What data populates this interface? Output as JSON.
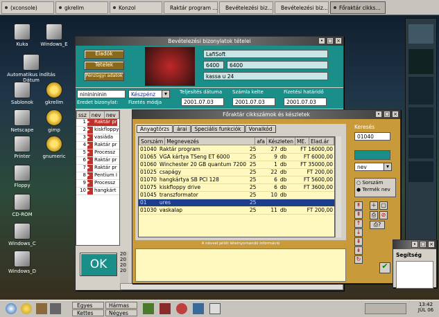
{
  "top_tasks": [
    {
      "label": "(xconsole)"
    },
    {
      "label": "gkrellm"
    },
    {
      "label": "Konzol"
    },
    {
      "label": "Raktár program ..."
    },
    {
      "label": "Bevételezési biz..."
    },
    {
      "label": "Bevételezési biz..."
    },
    {
      "label": "Főraktár cikks..."
    }
  ],
  "desktop_icons": [
    {
      "label": "Kuka"
    },
    {
      "label": "Windows_E"
    },
    {
      "label": "Automatikus indítás Dátum"
    },
    {
      "label": "Sablonok"
    },
    {
      "label": "gkrellm"
    },
    {
      "label": "Netscape"
    },
    {
      "label": "gimp"
    },
    {
      "label": "Printer"
    },
    {
      "label": "gnumeric"
    },
    {
      "label": "Floppy"
    },
    {
      "label": "CD-ROM"
    },
    {
      "label": "Windows_C"
    },
    {
      "label": "Windows_D"
    }
  ],
  "doc_window": {
    "title": "Bevételezési bizonylatok tételei",
    "buttons": {
      "eladok": "Eladók",
      "tetelek": "Tételek",
      "penzugyi": "Pénzügyi adatok"
    },
    "company": "LafiSoft",
    "code1": "6400",
    "code2": "6400",
    "address": "kassa u 24",
    "labels": {
      "teljesites": "Teljesítés dátuma",
      "szamla": "Számla kelte",
      "fizetesi_hatarido": "Fizetési határidő",
      "eredet": "Eredet bizonylat:",
      "fizetes_modja": "Fizetés módja"
    },
    "search_value": "nininininin",
    "payment": "Készpénz",
    "date1": "2001.07.03",
    "date2": "2001.07.03",
    "date3": "2001.07.03",
    "grid_headers": [
      "ssz",
      "nev",
      "nev"
    ],
    "rows": [
      {
        "n": "1",
        "c": "Raktár pr"
      },
      {
        "n": "2",
        "c": "kiskfloppy"
      },
      {
        "n": "3",
        "c": "vasiáda"
      },
      {
        "n": "4",
        "c": "Raktár pr"
      },
      {
        "n": "5",
        "c": "Processz"
      },
      {
        "n": "6",
        "c": "Raktár pr"
      },
      {
        "n": "7",
        "c": "Raktár pr"
      },
      {
        "n": "8",
        "c": "Pentium I"
      },
      {
        "n": "9",
        "c": "Processz"
      },
      {
        "n": "10",
        "c": "hangkárt"
      }
    ],
    "ok": "OK",
    "year_cells": [
      "20",
      "20",
      "20",
      "20"
    ]
  },
  "item_window": {
    "title": "Főraktár cikkszámok és készletek",
    "tabs": [
      "Anyagtörzs",
      "árai",
      "Speciális funkciók",
      "Vonalkód"
    ],
    "headers": [
      "Sorszám",
      "Megnevezés",
      "afa",
      "Készleten",
      "ME.",
      "Elad.ár"
    ],
    "rows": [
      {
        "code": "01040",
        "name": "Raktár program",
        "afa": "25",
        "stock": "27",
        "unit": "db",
        "price": "FT 16000,00"
      },
      {
        "code": "01065",
        "name": "VGA kártya TSeng ET 6000",
        "afa": "25",
        "stock": "9",
        "unit": "db",
        "price": "FT 6000,00"
      },
      {
        "code": "01060",
        "name": "Winchester 20 GB quantum 7200",
        "afa": "25",
        "stock": "1",
        "unit": "db",
        "price": "FT 35000,00"
      },
      {
        "code": "01025",
        "name": "csapágy",
        "afa": "25",
        "stock": "22",
        "unit": "db",
        "price": "FT 200,00"
      },
      {
        "code": "01070",
        "name": "hangkártya SB PCI 128",
        "afa": "25",
        "stock": "6",
        "unit": "db",
        "price": "FT 5600,00"
      },
      {
        "code": "01075",
        "name": "kiskfloppy drive",
        "afa": "25",
        "stock": "6",
        "unit": "db",
        "price": "FT 3600,00"
      },
      {
        "code": "01045",
        "name": "transzformator",
        "afa": "25",
        "stock": "10",
        "unit": "db",
        "price": ""
      },
      {
        "code": "01",
        "name": "ures",
        "afa": "25",
        "stock": "",
        "unit": "",
        "price": ""
      },
      {
        "code": "01030",
        "name": "vaskalap",
        "afa": "25",
        "stock": "11",
        "unit": "db",
        "price": "FT 200,00"
      }
    ],
    "selected_row": 7,
    "status_text": "A névvel jelölt lételnyomandó információ",
    "search_label": "Keresés",
    "search_value": "01040",
    "sort_field": "nev",
    "radio_sorszam": "Sorszám",
    "radio_termek": "Termék nev",
    "help": "Segítség"
  },
  "bottom": {
    "desk1": "Egyes",
    "desk2": "Hármas",
    "desk3": "Kettes",
    "desk4": "Négyes",
    "time": "13:42",
    "date": "JÚL 06"
  }
}
